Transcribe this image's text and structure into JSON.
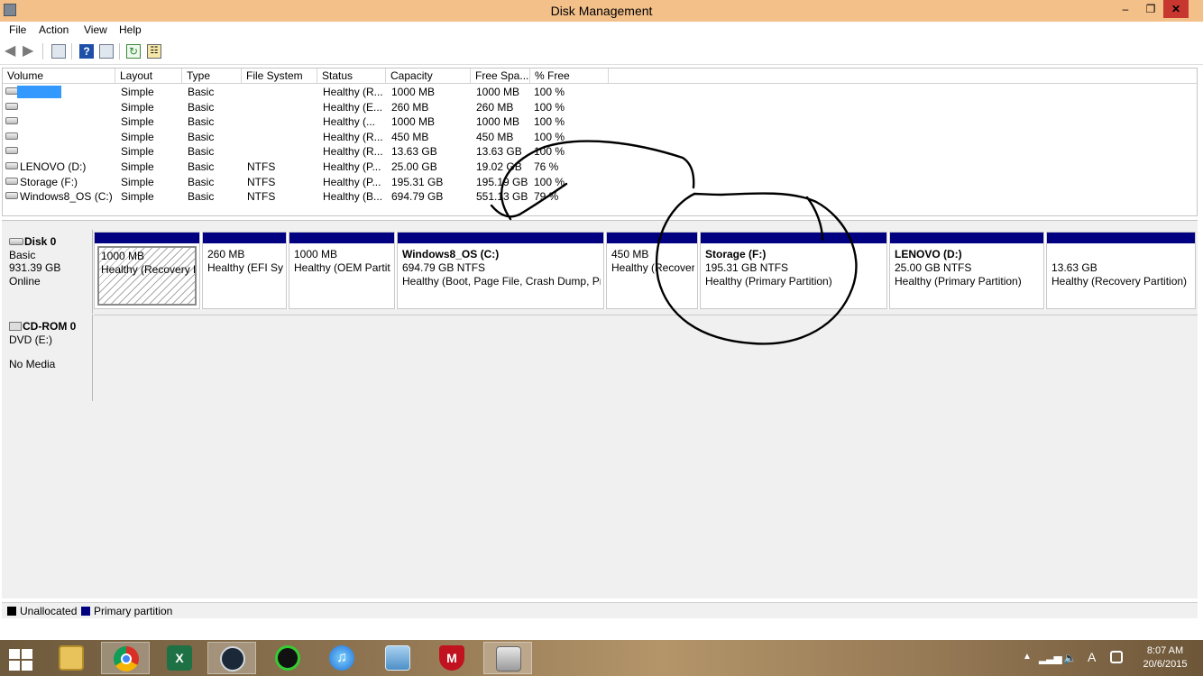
{
  "window": {
    "title": "Disk Management"
  },
  "menu": {
    "items": [
      "File",
      "Action",
      "View",
      "Help"
    ]
  },
  "toolbar": {
    "buttons": [
      "back-icon",
      "forward-icon",
      "console-tree-icon",
      "help-icon",
      "show-hide-icon",
      "refresh-icon",
      "properties-icon"
    ]
  },
  "volume_list": {
    "columns": [
      "Volume",
      "Layout",
      "Type",
      "File System",
      "Status",
      "Capacity",
      "Free Spa...",
      "% Free"
    ],
    "rows": [
      {
        "volume": "",
        "layout": "Simple",
        "type": "Basic",
        "fs": "",
        "status": "Healthy (R...",
        "capacity": "1000 MB",
        "free": "1000 MB",
        "pct": "100 %",
        "selected": true
      },
      {
        "volume": "",
        "layout": "Simple",
        "type": "Basic",
        "fs": "",
        "status": "Healthy (E...",
        "capacity": "260 MB",
        "free": "260 MB",
        "pct": "100 %"
      },
      {
        "volume": "",
        "layout": "Simple",
        "type": "Basic",
        "fs": "",
        "status": "Healthy (...",
        "capacity": "1000 MB",
        "free": "1000 MB",
        "pct": "100 %"
      },
      {
        "volume": "",
        "layout": "Simple",
        "type": "Basic",
        "fs": "",
        "status": "Healthy (R...",
        "capacity": "450 MB",
        "free": "450 MB",
        "pct": "100 %"
      },
      {
        "volume": "",
        "layout": "Simple",
        "type": "Basic",
        "fs": "",
        "status": "Healthy (R...",
        "capacity": "13.63 GB",
        "free": "13.63 GB",
        "pct": "100 %"
      },
      {
        "volume": "LENOVO (D:)",
        "layout": "Simple",
        "type": "Basic",
        "fs": "NTFS",
        "status": "Healthy (P...",
        "capacity": "25.00 GB",
        "free": "19.02 GB",
        "pct": "76 %"
      },
      {
        "volume": "Storage (F:)",
        "layout": "Simple",
        "type": "Basic",
        "fs": "NTFS",
        "status": "Healthy (P...",
        "capacity": "195.31 GB",
        "free": "195.19 GB",
        "pct": "100 %"
      },
      {
        "volume": "Windows8_OS (C:)",
        "layout": "Simple",
        "type": "Basic",
        "fs": "NTFS",
        "status": "Healthy (B...",
        "capacity": "694.79 GB",
        "free": "551.13 GB",
        "pct": "79 %"
      }
    ]
  },
  "disk0": {
    "name": "Disk 0",
    "type": "Basic",
    "size": "931.39 GB",
    "state": "Online",
    "partitions": [
      {
        "title": "",
        "line1": "1000 MB",
        "line2": "Healthy (Recovery P",
        "hatched": true
      },
      {
        "title": "",
        "line1": "260 MB",
        "line2": "Healthy (EFI Sys"
      },
      {
        "title": "",
        "line1": "1000 MB",
        "line2": "Healthy (OEM Partit"
      },
      {
        "title": "Windows8_OS  (C:)",
        "line1": "694.79 GB NTFS",
        "line2": "Healthy (Boot, Page File, Crash Dump, Prir"
      },
      {
        "title": "",
        "line1": "450 MB",
        "line2": "Healthy (Recover"
      },
      {
        "title": "Storage  (F:)",
        "line1": "195.31 GB NTFS",
        "line2": "Healthy (Primary Partition)"
      },
      {
        "title": "LENOVO  (D:)",
        "line1": "25.00 GB NTFS",
        "line2": "Healthy (Primary Partition)"
      },
      {
        "title": "",
        "line1": "13.63 GB",
        "line2": "Healthy (Recovery Partition)"
      }
    ]
  },
  "cdrom0": {
    "name": "CD-ROM 0",
    "drive": "DVD (E:)",
    "media": "No Media"
  },
  "legend": {
    "unallocated": "Unallocated",
    "primary": "Primary partition",
    "unallocated_color": "#000000",
    "primary_color": "#000080"
  },
  "taskbar": {
    "apps": [
      "file-explorer-icon",
      "chrome-icon",
      "excel-icon",
      "steam-icon",
      "green-alien-icon",
      "itunes-icon",
      "control-panel-icon",
      "mcafee-icon",
      "disk-management-icon"
    ],
    "clock_time": "8:07 AM",
    "clock_date": "20/6/2015",
    "ime": "A"
  },
  "colors": {
    "titlebar": "#f3c08a",
    "close_button": "#c7372f",
    "selection": "#3399ff",
    "partition_bar": "#000080"
  }
}
